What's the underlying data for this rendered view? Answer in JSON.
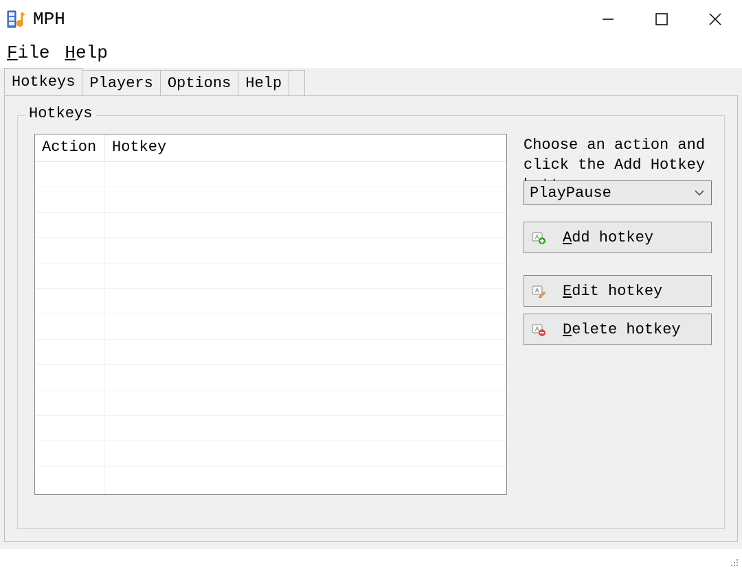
{
  "window": {
    "title": "MPH"
  },
  "menubar": {
    "file": "File",
    "help": "Help"
  },
  "tabs": {
    "hotkeys": "Hotkeys",
    "players": "Players",
    "options": "Options",
    "help": "Help",
    "active": "hotkeys"
  },
  "groupbox": {
    "title": "Hotkeys"
  },
  "listview": {
    "columns": {
      "action": "Action",
      "hotkey": "Hotkey"
    },
    "rows": []
  },
  "sidepanel": {
    "description": "Choose an action and click the Add Hotkey button:",
    "combo_value": "PlayPause",
    "combo_options": [
      "PlayPause"
    ],
    "add_button": "Add hotkey",
    "edit_button": "Edit hotkey",
    "delete_button": "Delete hotkey"
  }
}
